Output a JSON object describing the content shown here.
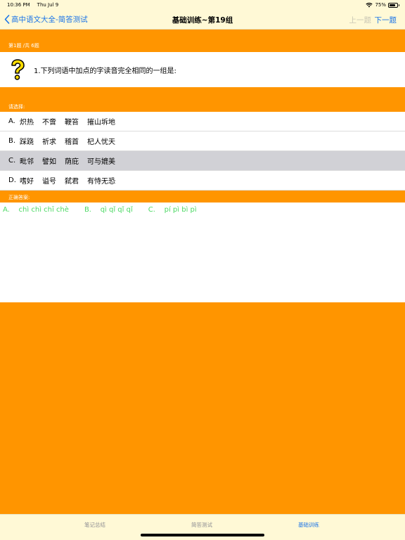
{
  "status": {
    "time": "10:36 PM",
    "date": "Thu Jul 9",
    "battery": "75%"
  },
  "nav": {
    "back_label": "高中语文大全-简答测试",
    "title": "基础训练~第19组",
    "prev_label": "上一题",
    "next_label": "下一题"
  },
  "progress_label": "第1题 /共 6题",
  "question": {
    "text": "1.下列词语中加点的字读音完全相同的一组是:"
  },
  "choose_label": "请选择:",
  "options": [
    {
      "letter": "A.",
      "words": [
        "炽热",
        "不啻",
        "鞭笞",
        "摧山坼地"
      ]
    },
    {
      "letter": "B.",
      "words": [
        "踩跷",
        "祈求",
        "稽首",
        "杞人忧天"
      ]
    },
    {
      "letter": "C.",
      "words": [
        "毗邻",
        "譬如",
        "荫庇",
        "可与媲美"
      ]
    },
    {
      "letter": "D.",
      "words": [
        "嗜好",
        "谥号",
        "弑君",
        "有恃无恐"
      ]
    }
  ],
  "selected_option": 2,
  "answer_label": "正确答案:",
  "answers": [
    "A.    chì chì chī chè",
    "B.    qì qǐ qǐ qǐ",
    "C.    pí pì bì pì"
  ],
  "tabs": [
    {
      "label": "笔记总结",
      "active": false
    },
    {
      "label": "简答测试",
      "active": false
    },
    {
      "label": "基础训练",
      "active": true
    }
  ],
  "colors": {
    "accent": "#ff9500",
    "bar_bg": "#fff9d6",
    "link": "#1a74e8",
    "answer": "#4cd964"
  }
}
